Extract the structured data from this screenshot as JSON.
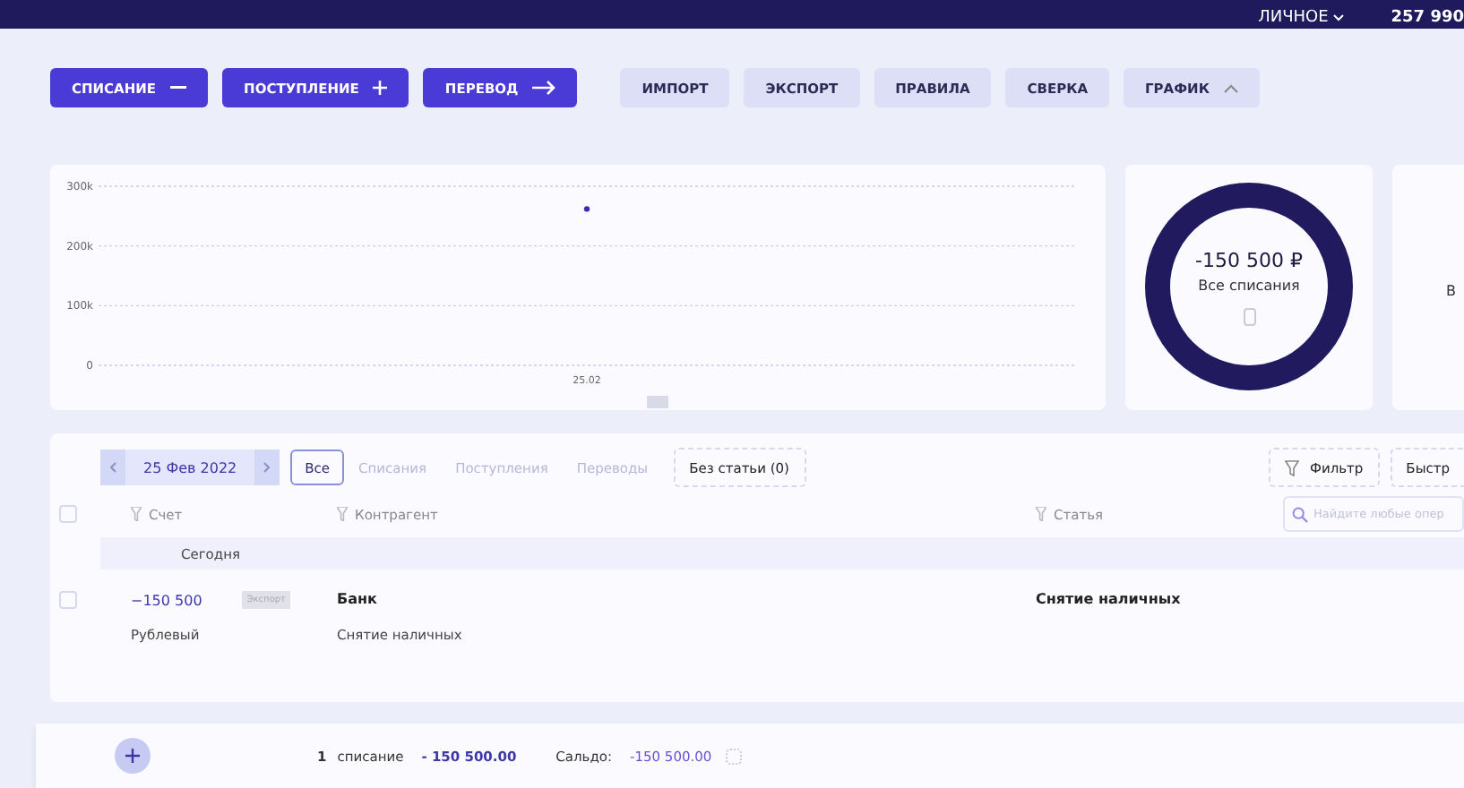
{
  "top_bar": {
    "profile": "ЛИЧНОЕ",
    "balance": "257 990"
  },
  "actions": [
    {
      "label": "СПИСАНИЕ",
      "kind": "minus"
    },
    {
      "label": "ПОСТУПЛЕНИЕ",
      "kind": "plus"
    },
    {
      "label": "ПЕРЕВОД",
      "kind": "arrow"
    }
  ],
  "tools": [
    {
      "label": "ИМПОРТ",
      "kind": "plain"
    },
    {
      "label": "ЭКСПОРТ",
      "kind": "plain"
    },
    {
      "label": "ПРАВИЛА",
      "kind": "plain"
    },
    {
      "label": "СВЕРКА",
      "kind": "plain"
    },
    {
      "label": "ГРАФИК",
      "kind": "toggle",
      "expanded": true
    }
  ],
  "chart": {
    "chart_data": {
      "type": "scatter",
      "x": [
        "25.02"
      ],
      "series": [
        {
          "color": "#3b2bb0",
          "values": [
            262000
          ]
        }
      ],
      "ylim": [
        0,
        300000
      ],
      "yticks": [
        {
          "value": 0,
          "label": "0"
        },
        {
          "value": 100000,
          "label": "100k"
        },
        {
          "value": 200000,
          "label": "200k"
        },
        {
          "value": 300000,
          "label": "300k"
        }
      ]
    }
  },
  "donut": {
    "amount": "-150 500 ₽",
    "label": "Все списания"
  },
  "side_card": {
    "text": "В"
  },
  "filters": {
    "date": "25 Фев 2022",
    "tabs": [
      {
        "label": "Все",
        "selected": true
      },
      {
        "label": "Списания",
        "selected": false
      },
      {
        "label": "Поступления",
        "selected": false
      },
      {
        "label": "Переводы",
        "selected": false
      }
    ],
    "no_category": "Без статьи (0)",
    "filter_button": "Фильтр",
    "quick_button": "Быстр"
  },
  "table": {
    "columns": [
      "Счет",
      "Контрагент",
      "Статья"
    ],
    "search_placeholder": "Найдите любые опер",
    "select_all_checked": false,
    "groups": [
      {
        "title": "Сегодня",
        "rows": [
          {
            "amount": "−150 500",
            "tag": "Экспорт",
            "account": "Рублевый",
            "counterparty": "Банк",
            "comment": "Снятие наличных",
            "category": "Снятие наличных",
            "checked": false
          }
        ]
      }
    ]
  },
  "footer": {
    "count": "1",
    "count_label": "списание",
    "sum": "- 150 500.00",
    "balance_label": "Сальдо:",
    "balance": "-150 500.00"
  }
}
